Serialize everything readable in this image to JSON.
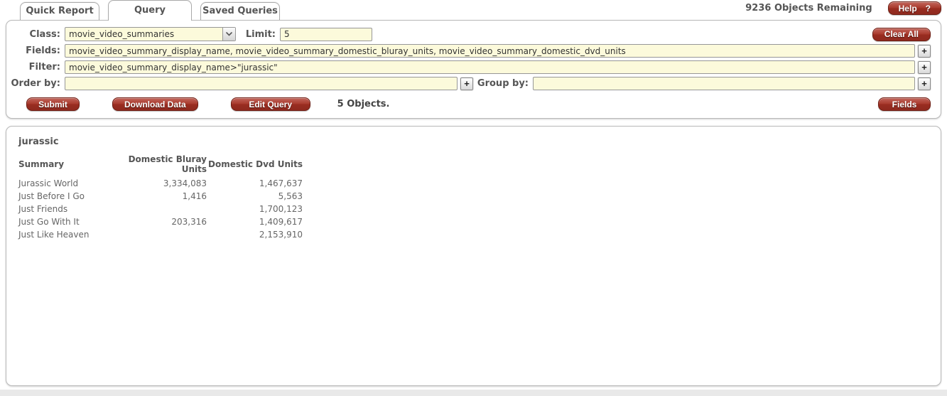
{
  "header": {
    "tabs": [
      {
        "label": "Quick Report",
        "active": false
      },
      {
        "label": "Query",
        "active": true
      },
      {
        "label": "Saved Queries",
        "active": false
      }
    ],
    "objects_remaining": "9236 Objects Remaining",
    "help_button": {
      "label": "Help",
      "icon": "?"
    }
  },
  "query_form": {
    "class_label": "Class:",
    "class_value": "movie_video_summaries",
    "limit_label": "Limit:",
    "limit_value": "5",
    "clear_all_label": "Clear All",
    "fields_label": "Fields:",
    "fields_value": "movie_video_summary_display_name, movie_video_summary_domestic_bluray_units, movie_video_summary_domestic_dvd_units",
    "filter_label": "Filter:",
    "filter_value": "movie_video_summary_display_name>\"jurassic\"",
    "order_by_label": "Order by:",
    "order_by_value": "",
    "group_by_label": "Group by:",
    "group_by_value": "",
    "add_button_label": "+",
    "submit_label": "Submit",
    "download_data_label": "Download Data",
    "edit_query_label": "Edit Query",
    "objects_count": "5 Objects.",
    "fields_button_label": "Fields"
  },
  "results": {
    "title": "jurassic",
    "table": {
      "columns": [
        "Summary",
        "Domestic Bluray Units",
        "Domestic Dvd Units"
      ],
      "rows": [
        [
          "Jurassic World",
          "3,334,083",
          "1,467,637"
        ],
        [
          "Just Before I Go",
          "1,416",
          "5,563"
        ],
        [
          "Just Friends",
          "",
          "1,700,123"
        ],
        [
          "Just Go With It",
          "203,316",
          "1,409,617"
        ],
        [
          "Just Like Heaven",
          "",
          "2,153,910"
        ]
      ]
    }
  },
  "colors": {
    "accent_red": "#A0301F",
    "input_yellow": "#FCFADB"
  }
}
